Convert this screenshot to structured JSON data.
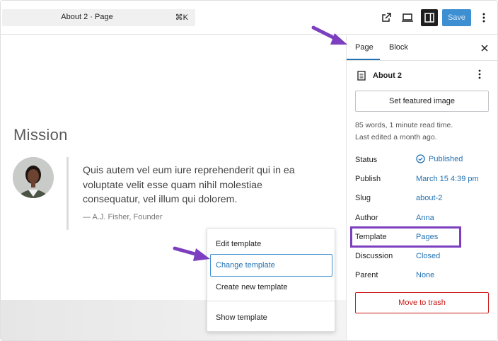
{
  "header": {
    "doc_title": "About 2 · Page",
    "shortcut": "⌘K",
    "save_label": "Save",
    "icons": [
      "external-link-icon",
      "desktop-preview-icon",
      "sidebar-toggle-icon",
      "options-icon"
    ]
  },
  "canvas": {
    "heading": "Mission",
    "quote_line1": "Quis autem vel eum iure reprehenderit qui in ea",
    "quote_line2": "voluptate velit esse quam nihil molestiae",
    "quote_line3": "consequatur, vel illum qui dolorem.",
    "citation": "— A.J. Fisher, Founder"
  },
  "template_menu": {
    "items": [
      "Edit template",
      "Change template",
      "Create new template",
      "Show template"
    ],
    "selected": "Change template"
  },
  "sidebar": {
    "tabs": [
      "Page",
      "Block"
    ],
    "active_tab": "Page",
    "doc_name": "About 2",
    "featured_image_label": "Set featured image",
    "word_count": "85 words, 1 minute read time.",
    "last_edited": "Last edited a month ago.",
    "rows": [
      {
        "label": "Status",
        "value": "Published"
      },
      {
        "label": "Publish",
        "value": "March 15 4:39 pm"
      },
      {
        "label": "Slug",
        "value": "about-2"
      },
      {
        "label": "Author",
        "value": "Anna"
      },
      {
        "label": "Template",
        "value": "Pages"
      },
      {
        "label": "Discussion",
        "value": "Closed"
      },
      {
        "label": "Parent",
        "value": "None"
      }
    ],
    "trash_label": "Move to trash"
  },
  "colors": {
    "accent": "#2271b1",
    "save_bg": "#3d8fd1",
    "highlight": "#7b3fbf",
    "danger": "#cc1818"
  }
}
